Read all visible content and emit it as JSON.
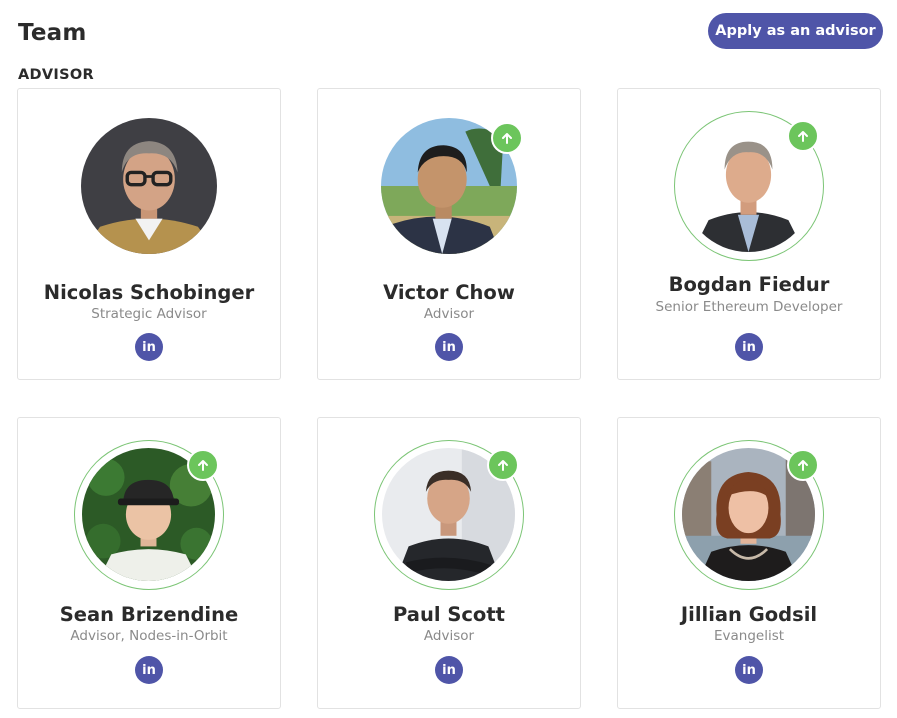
{
  "header": {
    "title": "Team",
    "apply_button": "Apply as an advisor"
  },
  "section": {
    "label": "ADVISOR"
  },
  "advisors": [
    {
      "name": "Nicolas Schobinger",
      "role": "Strategic Advisor",
      "linkedin": "in"
    },
    {
      "name": "Victor Chow",
      "role": "Advisor",
      "linkedin": "in"
    },
    {
      "name": "Bogdan Fiedur",
      "role": "Senior Ethereum Developer",
      "linkedin": "in"
    },
    {
      "name": "Sean Brizendine",
      "role": "Advisor, Nodes-in-Orbit",
      "linkedin": "in"
    },
    {
      "name": "Paul Scott",
      "role": "Advisor",
      "linkedin": "in"
    },
    {
      "name": "Jillian Godsil",
      "role": "Evangelist",
      "linkedin": "in"
    }
  ],
  "icons": {
    "badge": "arrow-up-icon",
    "social": "linkedin-icon"
  },
  "colors": {
    "accent": "#4f55a8",
    "badge_green": "#6cc55c",
    "ring_green": "#7cc576",
    "role_text": "#8a8a8a"
  }
}
